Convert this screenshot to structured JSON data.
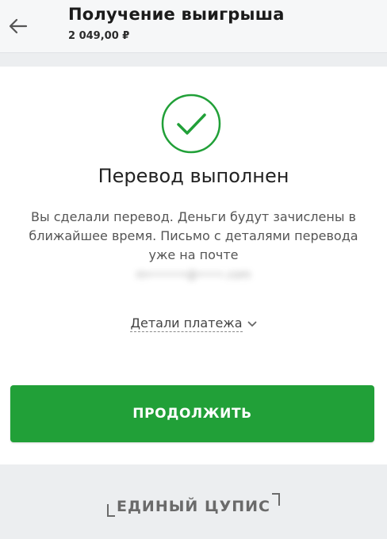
{
  "header": {
    "title": "Получение выигрыша",
    "amount": "2 049,00 ₽",
    "back_icon": "arrow-left-icon"
  },
  "result": {
    "icon": "checkmark-circle-icon",
    "title": "Перевод выполнен",
    "description": "Вы сделали перевод. Деньги будут зачислены в ближайшее время. Письмо с деталями перевода уже на почте",
    "email_masked": "m••••••@••••.com"
  },
  "details": {
    "label": "Детали платежа",
    "chevron_icon": "chevron-down-icon"
  },
  "actions": {
    "continue_label": "ПРОДОЛЖИТЬ"
  },
  "footer": {
    "logo_text": "ЕДИНЫЙ ЦУПИС"
  },
  "colors": {
    "accent_green": "#21a038",
    "check_green": "#21a038",
    "background": "#eceef0",
    "card": "#ffffff"
  }
}
